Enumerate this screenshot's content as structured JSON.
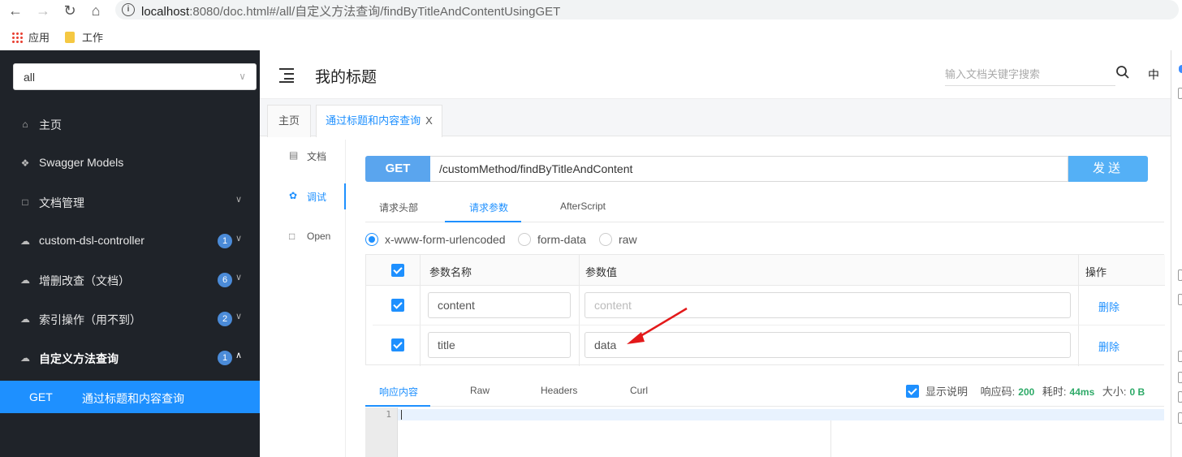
{
  "browser": {
    "url_host": "localhost",
    "url_rest": ":8080/doc.html#/all/自定义方法查询/findByTitleAndContentUsingGET",
    "bookmarks": [
      "应用",
      "工作"
    ]
  },
  "sidebar": {
    "group_select": "all",
    "items": [
      {
        "label": "主页",
        "icon": "home-icon"
      },
      {
        "label": "Swagger Models",
        "icon": "cube-icon"
      },
      {
        "label": "文档管理",
        "icon": "doc-icon"
      },
      {
        "label": "custom-dsl-controller",
        "icon": "cloud-icon",
        "badge": "1"
      },
      {
        "label": "增删改查（文档）",
        "icon": "cloud-icon",
        "badge": "6"
      },
      {
        "label": "索引操作（用不到）",
        "icon": "cloud-icon",
        "badge": "2"
      },
      {
        "label": "自定义方法查询",
        "icon": "cloud-icon",
        "badge": "1"
      }
    ],
    "sub_item": {
      "method": "GET",
      "title": "通过标题和内容查询"
    }
  },
  "header": {
    "title": "我的标题",
    "search_placeholder": "输入文档关键字搜索",
    "lang": "中"
  },
  "tabs": {
    "home": "主页",
    "api": "通过标题和内容查询",
    "close": "X"
  },
  "docnav": [
    "文档",
    "调试",
    "Open"
  ],
  "request": {
    "method": "GET",
    "url": "/customMethod/findByTitleAndContent",
    "send": "发送",
    "tabs": [
      "请求头部",
      "请求参数",
      "AfterScript"
    ],
    "content_types": [
      "x-www-form-urlencoded",
      "form-data",
      "raw"
    ],
    "selected_content_type": "x-www-form-urlencoded"
  },
  "params": {
    "headers": {
      "name": "参数名称",
      "value": "参数值",
      "action": "操作"
    },
    "rows": [
      {
        "name": "content",
        "value": "",
        "value_placeholder": "content",
        "action": "删除",
        "checked": true
      },
      {
        "name": "title",
        "value": "data",
        "value_placeholder": "",
        "action": "删除",
        "checked": true
      }
    ]
  },
  "response": {
    "tabs": [
      "响应内容",
      "Raw",
      "Headers",
      "Curl"
    ],
    "show_desc": "显示说明",
    "code_label": "响应码:",
    "code": "200",
    "time_label": "耗时:",
    "time": "44ms",
    "size_label": "大小:",
    "size": "0 B",
    "line_number": "1"
  },
  "colors": {
    "primary": "#1e90ff",
    "sidebar_bg": "#1f2329",
    "method_bg": "#5aa5ee",
    "success": "#2eaa68",
    "annotation_arrow": "#e3191a"
  }
}
